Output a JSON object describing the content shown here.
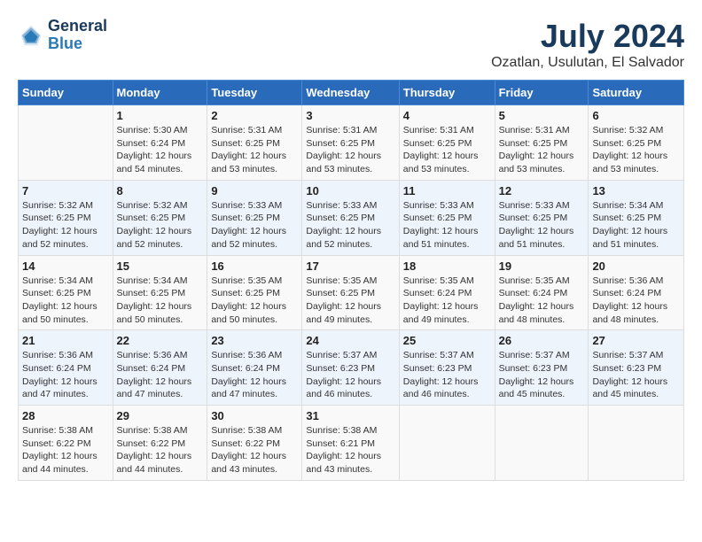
{
  "logo": {
    "line1": "General",
    "line2": "Blue"
  },
  "title": "July 2024",
  "location": "Ozatlan, Usulutan, El Salvador",
  "days_of_week": [
    "Sunday",
    "Monday",
    "Tuesday",
    "Wednesday",
    "Thursday",
    "Friday",
    "Saturday"
  ],
  "weeks": [
    [
      {
        "date": "",
        "info": ""
      },
      {
        "date": "1",
        "info": "Sunrise: 5:30 AM\nSunset: 6:24 PM\nDaylight: 12 hours\nand 54 minutes."
      },
      {
        "date": "2",
        "info": "Sunrise: 5:31 AM\nSunset: 6:25 PM\nDaylight: 12 hours\nand 53 minutes."
      },
      {
        "date": "3",
        "info": "Sunrise: 5:31 AM\nSunset: 6:25 PM\nDaylight: 12 hours\nand 53 minutes."
      },
      {
        "date": "4",
        "info": "Sunrise: 5:31 AM\nSunset: 6:25 PM\nDaylight: 12 hours\nand 53 minutes."
      },
      {
        "date": "5",
        "info": "Sunrise: 5:31 AM\nSunset: 6:25 PM\nDaylight: 12 hours\nand 53 minutes."
      },
      {
        "date": "6",
        "info": "Sunrise: 5:32 AM\nSunset: 6:25 PM\nDaylight: 12 hours\nand 53 minutes."
      }
    ],
    [
      {
        "date": "7",
        "info": "Sunrise: 5:32 AM\nSunset: 6:25 PM\nDaylight: 12 hours\nand 52 minutes."
      },
      {
        "date": "8",
        "info": "Sunrise: 5:32 AM\nSunset: 6:25 PM\nDaylight: 12 hours\nand 52 minutes."
      },
      {
        "date": "9",
        "info": "Sunrise: 5:33 AM\nSunset: 6:25 PM\nDaylight: 12 hours\nand 52 minutes."
      },
      {
        "date": "10",
        "info": "Sunrise: 5:33 AM\nSunset: 6:25 PM\nDaylight: 12 hours\nand 52 minutes."
      },
      {
        "date": "11",
        "info": "Sunrise: 5:33 AM\nSunset: 6:25 PM\nDaylight: 12 hours\nand 51 minutes."
      },
      {
        "date": "12",
        "info": "Sunrise: 5:33 AM\nSunset: 6:25 PM\nDaylight: 12 hours\nand 51 minutes."
      },
      {
        "date": "13",
        "info": "Sunrise: 5:34 AM\nSunset: 6:25 PM\nDaylight: 12 hours\nand 51 minutes."
      }
    ],
    [
      {
        "date": "14",
        "info": "Sunrise: 5:34 AM\nSunset: 6:25 PM\nDaylight: 12 hours\nand 50 minutes."
      },
      {
        "date": "15",
        "info": "Sunrise: 5:34 AM\nSunset: 6:25 PM\nDaylight: 12 hours\nand 50 minutes."
      },
      {
        "date": "16",
        "info": "Sunrise: 5:35 AM\nSunset: 6:25 PM\nDaylight: 12 hours\nand 50 minutes."
      },
      {
        "date": "17",
        "info": "Sunrise: 5:35 AM\nSunset: 6:25 PM\nDaylight: 12 hours\nand 49 minutes."
      },
      {
        "date": "18",
        "info": "Sunrise: 5:35 AM\nSunset: 6:24 PM\nDaylight: 12 hours\nand 49 minutes."
      },
      {
        "date": "19",
        "info": "Sunrise: 5:35 AM\nSunset: 6:24 PM\nDaylight: 12 hours\nand 48 minutes."
      },
      {
        "date": "20",
        "info": "Sunrise: 5:36 AM\nSunset: 6:24 PM\nDaylight: 12 hours\nand 48 minutes."
      }
    ],
    [
      {
        "date": "21",
        "info": "Sunrise: 5:36 AM\nSunset: 6:24 PM\nDaylight: 12 hours\nand 47 minutes."
      },
      {
        "date": "22",
        "info": "Sunrise: 5:36 AM\nSunset: 6:24 PM\nDaylight: 12 hours\nand 47 minutes."
      },
      {
        "date": "23",
        "info": "Sunrise: 5:36 AM\nSunset: 6:24 PM\nDaylight: 12 hours\nand 47 minutes."
      },
      {
        "date": "24",
        "info": "Sunrise: 5:37 AM\nSunset: 6:23 PM\nDaylight: 12 hours\nand 46 minutes."
      },
      {
        "date": "25",
        "info": "Sunrise: 5:37 AM\nSunset: 6:23 PM\nDaylight: 12 hours\nand 46 minutes."
      },
      {
        "date": "26",
        "info": "Sunrise: 5:37 AM\nSunset: 6:23 PM\nDaylight: 12 hours\nand 45 minutes."
      },
      {
        "date": "27",
        "info": "Sunrise: 5:37 AM\nSunset: 6:23 PM\nDaylight: 12 hours\nand 45 minutes."
      }
    ],
    [
      {
        "date": "28",
        "info": "Sunrise: 5:38 AM\nSunset: 6:22 PM\nDaylight: 12 hours\nand 44 minutes."
      },
      {
        "date": "29",
        "info": "Sunrise: 5:38 AM\nSunset: 6:22 PM\nDaylight: 12 hours\nand 44 minutes."
      },
      {
        "date": "30",
        "info": "Sunrise: 5:38 AM\nSunset: 6:22 PM\nDaylight: 12 hours\nand 43 minutes."
      },
      {
        "date": "31",
        "info": "Sunrise: 5:38 AM\nSunset: 6:21 PM\nDaylight: 12 hours\nand 43 minutes."
      },
      {
        "date": "",
        "info": ""
      },
      {
        "date": "",
        "info": ""
      },
      {
        "date": "",
        "info": ""
      }
    ]
  ]
}
